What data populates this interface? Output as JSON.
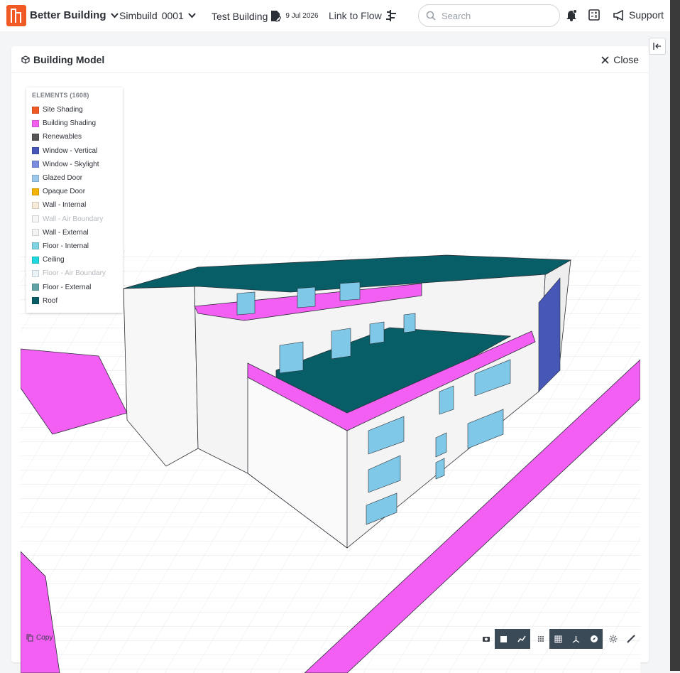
{
  "header": {
    "brand": "Better Building",
    "simbuild_label": "Simbuild",
    "simbuild_number": "0001",
    "building_name": "Test Building",
    "building_date": "9 Jul 2026",
    "flow_link": "Link to Flow",
    "search_placeholder": "Search",
    "support_label": "Support",
    "brand_color": "#f15a24"
  },
  "panel": {
    "title": "Building Model",
    "close_label": "Close"
  },
  "legend": {
    "title": "ELEMENTS (1608)",
    "items": [
      {
        "label": "Site Shading",
        "color": "#f15a24",
        "faded": false
      },
      {
        "label": "Building Shading",
        "color": "#f25ff2",
        "faded": false
      },
      {
        "label": "Renewables",
        "color": "#555555",
        "faded": false
      },
      {
        "label": "Window - Vertical",
        "color": "#4657b8",
        "faded": false
      },
      {
        "label": "Window - Skylight",
        "color": "#7b8ce0",
        "faded": false
      },
      {
        "label": "Glazed Door",
        "color": "#9cc8ee",
        "faded": false
      },
      {
        "label": "Opaque Door",
        "color": "#f5b400",
        "faded": false
      },
      {
        "label": "Wall - Internal",
        "color": "#f7ecd9",
        "faded": false
      },
      {
        "label": "Wall - Air Boundary",
        "color": "#f6f6f6",
        "faded": true
      },
      {
        "label": "Wall - External",
        "color": "#f4f4f4",
        "faded": false
      },
      {
        "label": "Floor - Internal",
        "color": "#7fd3e3",
        "faded": false
      },
      {
        "label": "Ceiling",
        "color": "#1fd8e0",
        "faded": false
      },
      {
        "label": "Floor - Air Boundary",
        "color": "#eaf3f8",
        "faded": true
      },
      {
        "label": "Floor - External",
        "color": "#5fa3a6",
        "faded": false
      },
      {
        "label": "Roof",
        "color": "#075e66",
        "faded": false
      }
    ]
  },
  "toolbar": {
    "copy_label": "Copy",
    "tools": [
      "camera-icon",
      "cube-icon",
      "line-chart-icon",
      "dots-grid-icon",
      "grid-icon",
      "axes-icon",
      "compass-icon",
      "sun-icon",
      "ruler-icon"
    ]
  }
}
